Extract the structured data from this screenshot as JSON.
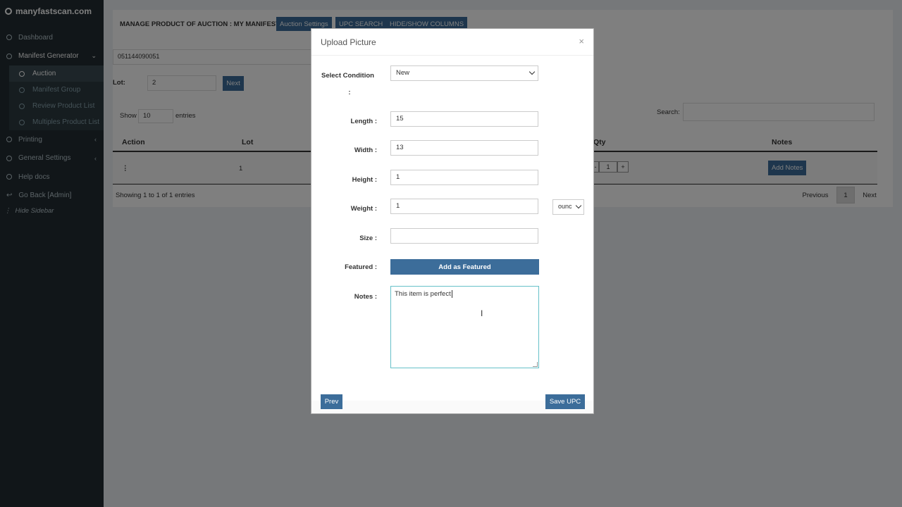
{
  "sidebar": {
    "brand": "manyfastscan.com",
    "items": [
      {
        "label": "Dashboard"
      },
      {
        "label": "Manifest Generator"
      },
      {
        "label": "Printing"
      },
      {
        "label": "General Settings"
      },
      {
        "label": "Help docs"
      },
      {
        "label": "Go Back [Admin]"
      }
    ],
    "sub_items": [
      {
        "label": "Auction"
      },
      {
        "label": "Manifest Group"
      },
      {
        "label": "Review Product List"
      },
      {
        "label": "Multiples Product List"
      }
    ],
    "hide_label": "Hide Sidebar"
  },
  "page": {
    "title": "MANAGE PRODUCT OF AUCTION : MY MANIFEST",
    "buttons": [
      "Auction Settings",
      "UPC SEARCH",
      "HIDE/SHOW COLUMNS"
    ],
    "upc_value": "051144090051",
    "lot_label": "Lot:",
    "lot_value": "2",
    "next_label": "Next",
    "show_label": "Show",
    "show_value": "10",
    "entries_label": "entries",
    "search_label": "Search:",
    "table": {
      "headers": [
        "Action",
        "Lot",
        "Qty",
        "Notes"
      ],
      "row": {
        "action": "⋮",
        "lot": "1",
        "qty": "1",
        "qty_minus": "-",
        "qty_plus": "+",
        "notes_btn": "Add Notes"
      }
    },
    "showing": "Showing 1 to 1 of 1 entries",
    "pager": {
      "prev": "Previous",
      "page": "1",
      "next": "Next"
    }
  },
  "modal": {
    "title": "Upload Picture",
    "close": "×",
    "fields": {
      "condition_label": "Select Condition",
      "condition_colon": ":",
      "condition_value": "New",
      "length_label": "Length :",
      "length_value": "15",
      "width_label": "Width :",
      "width_value": "13",
      "height_label": "Height :",
      "height_value": "1",
      "weight_label": "Weight :",
      "weight_value": "1",
      "weight_unit": "ounc",
      "size_label": "Size :",
      "size_value": "",
      "featured_label": "Featured :",
      "featured_button": "Add as Featured",
      "notes_label": "Notes :",
      "notes_value": "This item is perfect"
    },
    "prev_label": "Prev",
    "save_label": "Save UPC"
  }
}
